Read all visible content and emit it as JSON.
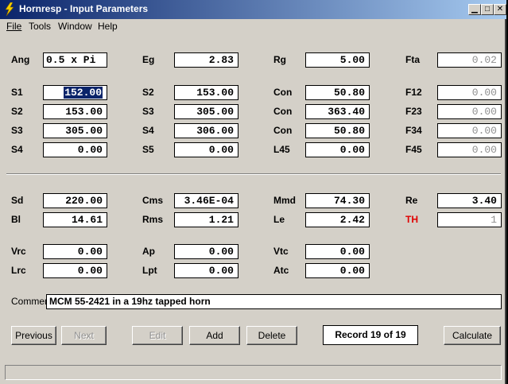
{
  "window": {
    "title": "Hornresp - Input Parameters"
  },
  "menu": {
    "file": "File",
    "tools": "Tools",
    "window": "Window",
    "help": "Help"
  },
  "params": {
    "ang": {
      "label": "Ang",
      "value": "0.5 x Pi"
    },
    "eg": {
      "label": "Eg",
      "value": "2.83"
    },
    "rg": {
      "label": "Rg",
      "value": "5.00"
    },
    "fta": {
      "label": "Fta",
      "value": "0.02"
    },
    "s1": {
      "label": "S1",
      "value": "152.00"
    },
    "s2a": {
      "label": "S2",
      "value": "153.00"
    },
    "con1": {
      "label": "Con",
      "value": "50.80"
    },
    "f12": {
      "label": "F12",
      "value": "0.00"
    },
    "s2b": {
      "label": "S2",
      "value": "153.00"
    },
    "s3a": {
      "label": "S3",
      "value": "305.00"
    },
    "con2": {
      "label": "Con",
      "value": "363.40"
    },
    "f23": {
      "label": "F23",
      "value": "0.00"
    },
    "s3b": {
      "label": "S3",
      "value": "305.00"
    },
    "s4a": {
      "label": "S4",
      "value": "306.00"
    },
    "con3": {
      "label": "Con",
      "value": "50.80"
    },
    "f34": {
      "label": "F34",
      "value": "0.00"
    },
    "s4b": {
      "label": "S4",
      "value": "0.00"
    },
    "s5": {
      "label": "S5",
      "value": "0.00"
    },
    "l45": {
      "label": "L45",
      "value": "0.00"
    },
    "f45": {
      "label": "F45",
      "value": "0.00"
    },
    "sd": {
      "label": "Sd",
      "value": "220.00"
    },
    "cms": {
      "label": "Cms",
      "value": "3.46E-04"
    },
    "mmd": {
      "label": "Mmd",
      "value": "74.30"
    },
    "re": {
      "label": "Re",
      "value": "3.40"
    },
    "bl": {
      "label": "Bl",
      "value": "14.61"
    },
    "rms": {
      "label": "Rms",
      "value": "1.21"
    },
    "le": {
      "label": "Le",
      "value": "2.42"
    },
    "th": {
      "label": "TH",
      "value": "1"
    },
    "vrc": {
      "label": "Vrc",
      "value": "0.00"
    },
    "ap": {
      "label": "Ap",
      "value": "0.00"
    },
    "vtc": {
      "label": "Vtc",
      "value": "0.00"
    },
    "lrc": {
      "label": "Lrc",
      "value": "0.00"
    },
    "lpt": {
      "label": "Lpt",
      "value": "0.00"
    },
    "atc": {
      "label": "Atc",
      "value": "0.00"
    }
  },
  "comment": {
    "label": "Comment",
    "value": "MCM 55-2421 in a 19hz tapped horn"
  },
  "buttons": {
    "previous": "Previous",
    "next": "Next",
    "edit": "Edit",
    "add": "Add",
    "delete": "Delete",
    "calculate": "Calculate"
  },
  "record": "Record 19 of 19",
  "colors": {
    "titlebar_start": "#0a246a",
    "titlebar_end": "#a6caf0",
    "face": "#d4d0c8",
    "th_label": "#e00000"
  }
}
